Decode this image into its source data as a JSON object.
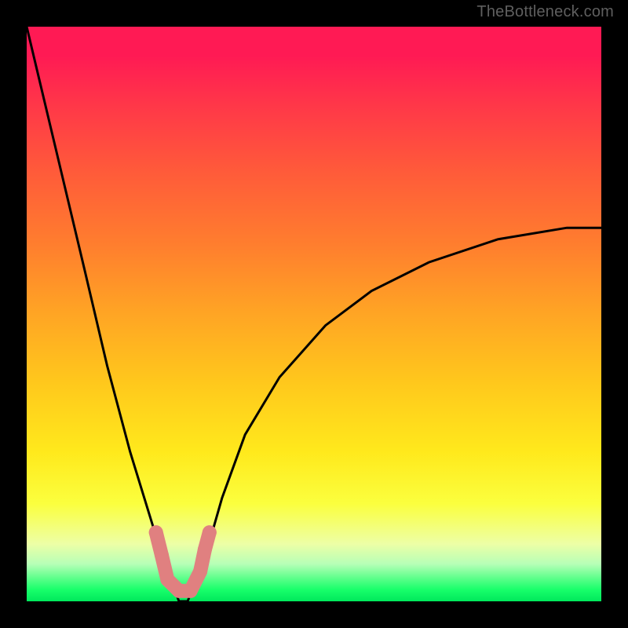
{
  "watermark": "TheBottleneck.com",
  "chart_data": {
    "type": "line",
    "title": "",
    "xlabel": "",
    "ylabel": "",
    "xlim": [
      0,
      100
    ],
    "ylim": [
      0,
      100
    ],
    "main_curve": {
      "name": "bottleneck-curve",
      "x": [
        0,
        5,
        10,
        14,
        18,
        22,
        25,
        26.5,
        28,
        30,
        32,
        34,
        38,
        44,
        52,
        60,
        70,
        82,
        94,
        100
      ],
      "y": [
        100,
        79,
        58,
        41,
        26,
        13,
        4,
        0,
        0,
        5,
        11,
        18,
        29,
        39,
        48,
        54,
        59,
        63,
        65,
        65
      ]
    },
    "threshold_band": {
      "note": "green safe zone sits roughly 0-4 on y",
      "y_range": [
        0,
        4
      ]
    },
    "markers": {
      "note": "salmon rounded beads outlining the dip of the curve",
      "points": [
        {
          "x": 22.5,
          "y": 12
        },
        {
          "x": 23.5,
          "y": 8
        },
        {
          "x": 24.5,
          "y": 3.8
        },
        {
          "x": 26.5,
          "y": 1.8
        },
        {
          "x": 28.5,
          "y": 1.8
        },
        {
          "x": 30.2,
          "y": 5.2
        },
        {
          "x": 31.0,
          "y": 9
        },
        {
          "x": 31.8,
          "y": 12
        }
      ]
    },
    "gradient_stops": [
      {
        "pct": 0,
        "color": "#ff1a54"
      },
      {
        "pct": 50,
        "color": "#ffa524"
      },
      {
        "pct": 83,
        "color": "#fbff3e"
      },
      {
        "pct": 100,
        "color": "#00e85c"
      }
    ]
  }
}
